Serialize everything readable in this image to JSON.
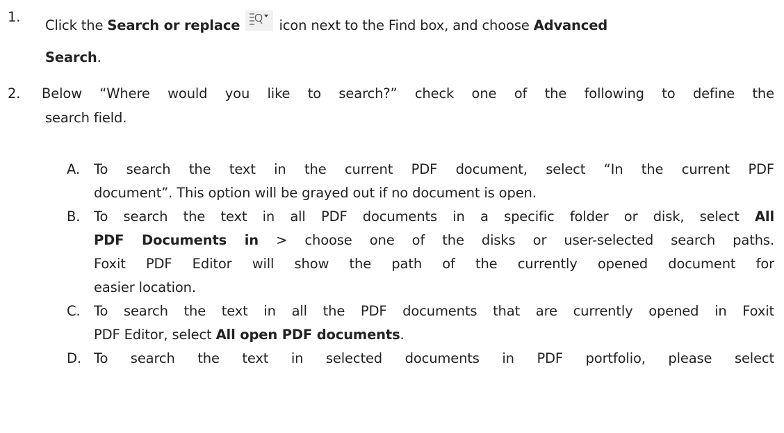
{
  "step1": {
    "number": "1.",
    "pre": "Click the ",
    "bold1": "Search or replace",
    "icon": "search-list-dropdown-icon",
    "mid": " icon next to the Find box, and choose ",
    "bold2a": "Advanced",
    "bold2b": "Search",
    "end": "."
  },
  "step2": {
    "number": "2.",
    "line1": "Below “Where would you like to search?” check one of the following to define the",
    "line2": "search field."
  },
  "options": {
    "A": {
      "letter": "A.",
      "line1": "To search the text in the current PDF document, select “In the current PDF",
      "line2": "document”. This option will be grayed out if no document is open."
    },
    "B": {
      "letter": "B.",
      "line1": "To search the text in all PDF documents in a specific folder or disk, select ",
      "line1_bold": "All",
      "line2_bold": "PDF Documents in",
      "line2": " > choose one of the disks or user-selected search paths.",
      "line3": "Foxit PDF Editor will show the path of the currently opened document for",
      "line4": "easier location."
    },
    "C": {
      "letter": "C.",
      "line1": "To search the text in all the PDF documents that are currently opened in Foxit",
      "line2_pre": "PDF Editor, select ",
      "line2_bold": "All open PDF documents",
      "line2_end": "."
    },
    "D": {
      "letter": "D.",
      "line1": "To search the text in selected documents in PDF portfolio, please select"
    }
  }
}
